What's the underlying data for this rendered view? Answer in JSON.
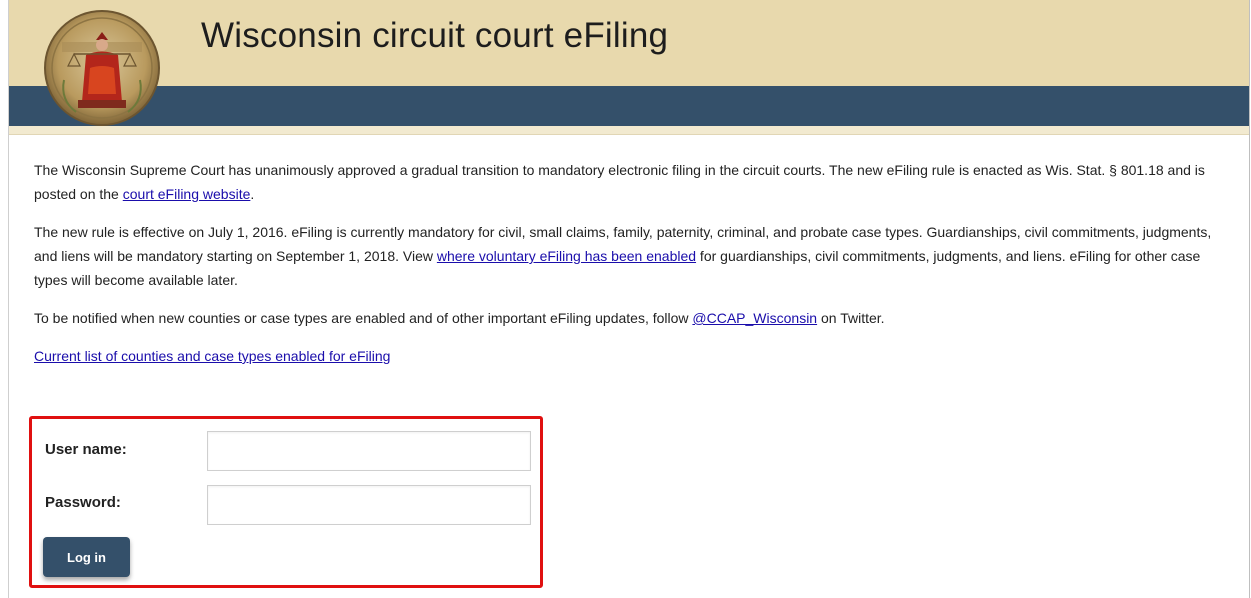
{
  "header": {
    "title": "Wisconsin circuit court eFiling",
    "seal_icon": "court-seal-icon"
  },
  "intro": {
    "p1_before_link": "The Wisconsin Supreme Court has unanimously approved a gradual transition to mandatory electronic filing in the circuit courts. The new eFiling rule is enacted as Wis. Stat. § 801.18 and is posted on the ",
    "p1_link": "court eFiling website",
    "p1_after_link": ".",
    "p2_before_link": "The new rule is effective on July 1, 2016. eFiling is currently mandatory for civil, small claims, family, paternity, criminal, and probate case types. Guardianships, civil commitments, judgments, and liens will be mandatory starting on September 1, 2018. View ",
    "p2_link": "where voluntary eFiling has been enabled",
    "p2_after_link": " for guardianships, civil commitments, judgments, and liens. eFiling for other case types will become available later.",
    "p3_before_link": "To be notified when new counties or case types are enabled and of other important eFiling updates, follow ",
    "p3_link": "@CCAP_Wisconsin",
    "p3_after_link": " on Twitter.",
    "counties_link": "Current list of counties and case types enabled for eFiling"
  },
  "login": {
    "username_label": "User name:",
    "username_value": "",
    "password_label": "Password:",
    "password_value": "",
    "submit_label": "Log in"
  },
  "colors": {
    "header_band": "#e8d9ad",
    "nav_band": "#34506a",
    "link": "#1a0dab",
    "highlight_border": "#e01010",
    "button": "#34506a"
  }
}
